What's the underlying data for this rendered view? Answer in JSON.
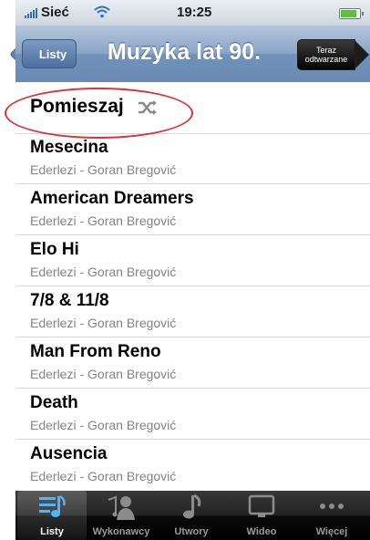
{
  "statusbar": {
    "carrier": "Sieć",
    "time": "19:25",
    "battery_level": 0.85
  },
  "navbar": {
    "back_label": "Listy",
    "title": "Muzyka lat 90.",
    "now_playing_line1": "Teraz",
    "now_playing_line2": "odtwarzane"
  },
  "shuffle": {
    "label": "Pomieszaj",
    "icon": "shuffle-icon"
  },
  "tracks": [
    {
      "title": "Mesecina",
      "subtitle": "Ederlezi - Goran Bregović"
    },
    {
      "title": "American Dreamers",
      "subtitle": "Ederlezi - Goran Bregović"
    },
    {
      "title": "Elo Hi",
      "subtitle": "Ederlezi - Goran Bregović"
    },
    {
      "title": "7/8 & 11/8",
      "subtitle": "Ederlezi - Goran Bregović"
    },
    {
      "title": "Man From Reno",
      "subtitle": "Ederlezi - Goran Bregović"
    },
    {
      "title": "Death",
      "subtitle": "Ederlezi - Goran Bregović"
    },
    {
      "title": "Ausencia",
      "subtitle": "Ederlezi - Goran Bregović"
    }
  ],
  "tabs": [
    {
      "label": "Listy",
      "icon": "playlist-icon",
      "active": true
    },
    {
      "label": "Wykonawcy",
      "icon": "artist-icon",
      "active": false
    },
    {
      "label": "Utwory",
      "icon": "music-note-icon",
      "active": false
    },
    {
      "label": "Wideo",
      "icon": "video-icon",
      "active": false
    },
    {
      "label": "Więcej",
      "icon": "more-icon",
      "active": false
    }
  ],
  "colors": {
    "nav": "#7092ba",
    "highlight": "#d9343d",
    "tabbar": "#000000"
  }
}
